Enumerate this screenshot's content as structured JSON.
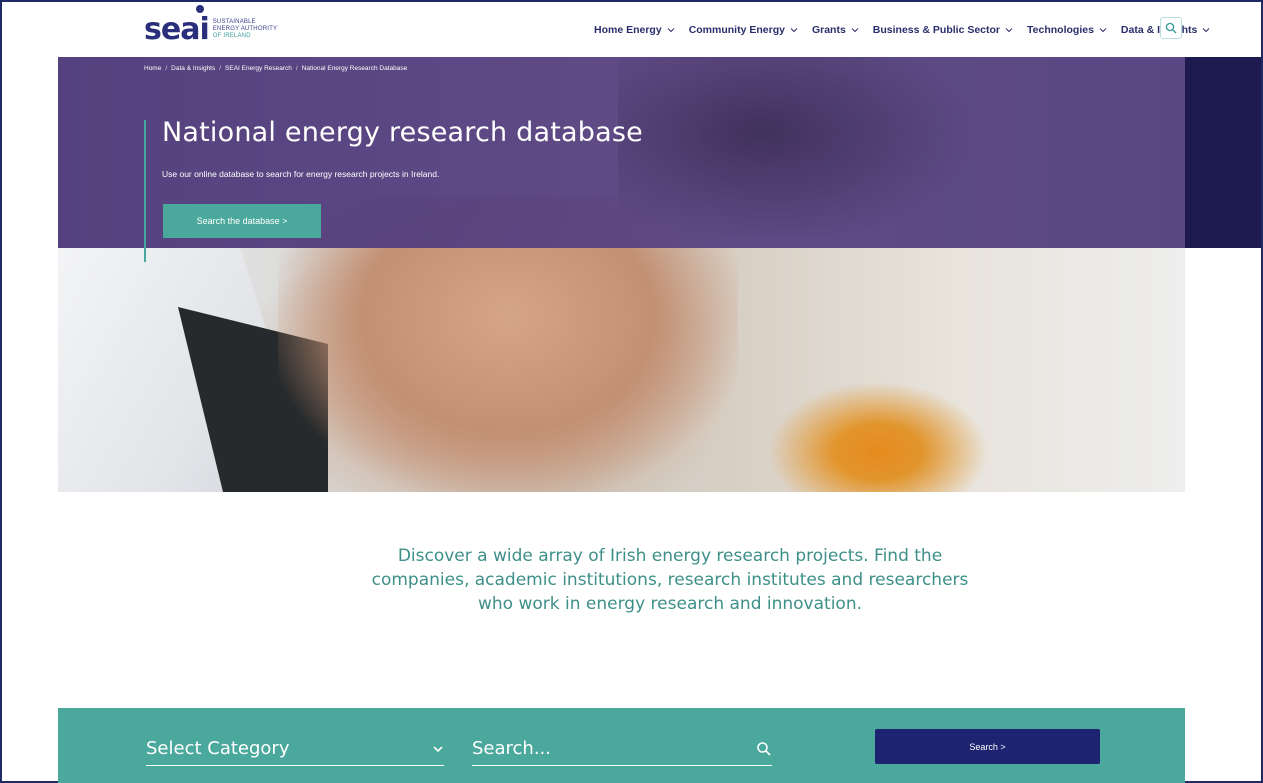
{
  "logo": {
    "wordmark": "seai",
    "tagline": [
      "SUSTAINABLE",
      "ENERGY AUTHORITY",
      "OF IRELAND"
    ],
    "brand_color": "#2a2f7c",
    "accent_color": "#3b9e9a"
  },
  "nav": {
    "items": [
      {
        "label": "Home Energy",
        "icon": "chevron-down-icon"
      },
      {
        "label": "Community Energy",
        "icon": "chevron-down-icon"
      },
      {
        "label": "Grants",
        "icon": "chevron-down-icon"
      },
      {
        "label": "Business & Public Sector",
        "icon": "chevron-down-icon"
      },
      {
        "label": "Technologies",
        "icon": "chevron-down-icon"
      },
      {
        "label": "Data & Insights",
        "icon": "chevron-down-icon"
      }
    ],
    "search_icon": "search-icon"
  },
  "breadcrumb": [
    "Home",
    "Data & Insights",
    "SEAI Energy Research",
    "National Energy Research Database"
  ],
  "hero": {
    "title": "National energy research database",
    "subtitle": "Use our online database to search for energy research projects in Ireland.",
    "cta_label": "Search the database >",
    "overlay_color": "#4e3a7a"
  },
  "intro": {
    "text": "Discover a wide array of Irish energy research projects. Find the companies, academic institutions, research institutes and researchers who work in energy research and innovation."
  },
  "search": {
    "category_value": "Select Category",
    "category_icon": "chevron-down-icon",
    "query_placeholder": "Search...",
    "query_icon": "search-icon",
    "submit_label": "Search >",
    "bar_color": "#4aa89c",
    "button_color": "#1d2370"
  }
}
